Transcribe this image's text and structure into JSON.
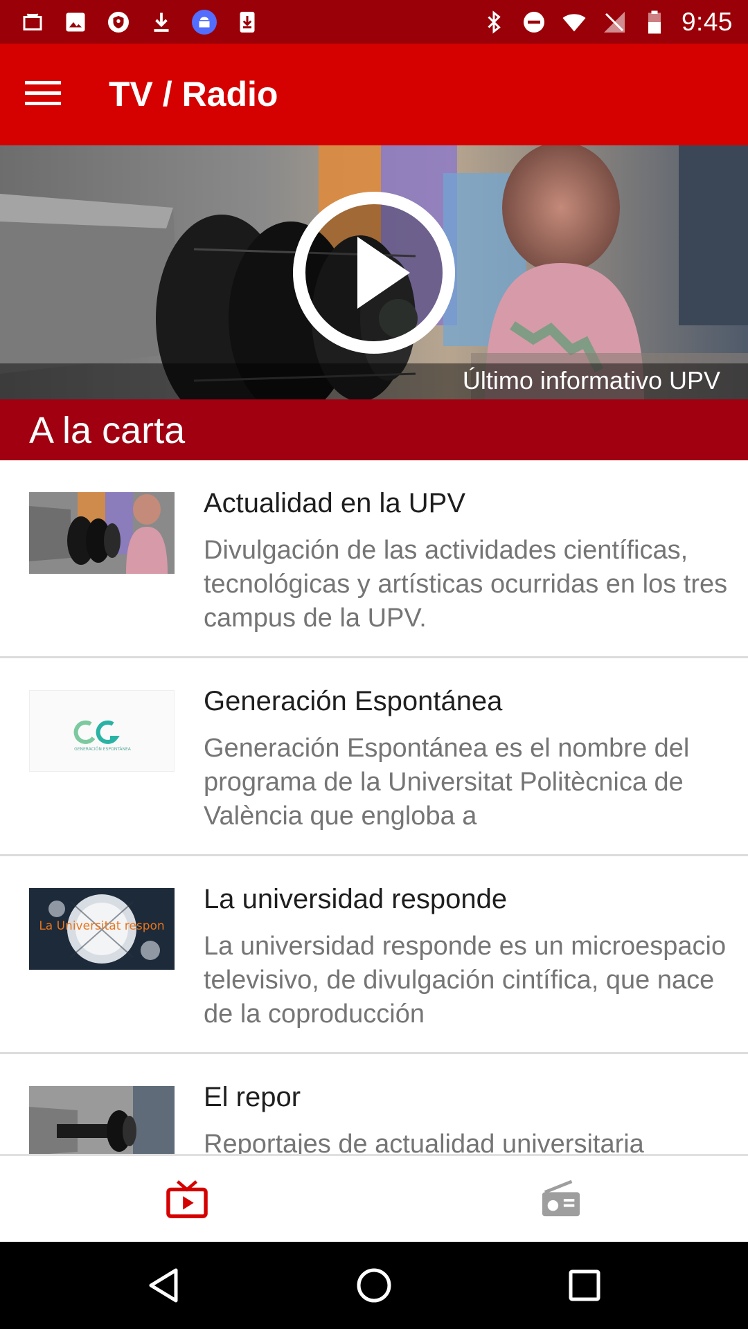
{
  "status_bar": {
    "time": "9:45",
    "left_icons": [
      "briefcase-icon",
      "image-icon",
      "shield-icon",
      "download-icon",
      "android-icon",
      "download-box-icon"
    ],
    "right_icons": [
      "bluetooth-icon",
      "do-not-disturb-icon",
      "wifi-icon",
      "no-signal-icon",
      "battery-icon"
    ]
  },
  "app_bar": {
    "title": "TV / Radio",
    "menu_icon": "menu-icon"
  },
  "hero": {
    "caption": "Último informativo UPV",
    "play_icon": "play-icon"
  },
  "section": {
    "title": "A la carta"
  },
  "list": {
    "items": [
      {
        "title": "Actualidad en la UPV",
        "description": "Divulgación de las actividades científicas, tecnológicas y artísticas ocurridas en los tres campus de la UPV."
      },
      {
        "title": "Generación Espontánea",
        "description": "Generación Espontánea es el nombre del programa de la Universitat Politècnica de València que engloba a",
        "thumb_caption": "GENERACIÓN ESPONTÁNEA"
      },
      {
        "title": "La universidad responde",
        "description": "La universidad responde es un microespacio televisivo, de divulgación cintífica, que nace de la coproducción",
        "thumb_text": "La Universitat respon"
      },
      {
        "title": "El repor",
        "description": "Reportajes de actualidad universitaria"
      }
    ]
  },
  "bottom_nav": {
    "tabs": [
      {
        "icon": "tv-icon",
        "active": true
      },
      {
        "icon": "radio-icon",
        "active": false
      }
    ]
  },
  "system_nav": {
    "buttons": [
      "back-icon",
      "home-icon",
      "recents-icon"
    ]
  },
  "colors": {
    "status_bar": "#9a0007",
    "app_bar": "#d50000",
    "section_header": "#a00010",
    "active_tab": "#d50000",
    "inactive_tab": "#9e9e9e"
  }
}
